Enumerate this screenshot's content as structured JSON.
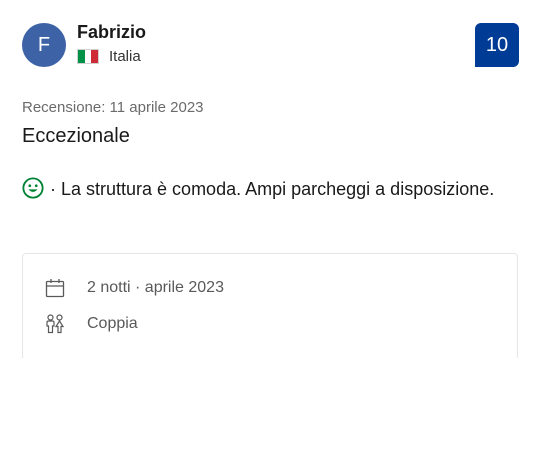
{
  "reviewer": {
    "initial": "F",
    "name": "Fabrizio",
    "country": "Italia",
    "flag_icon": "flag-italy-icon",
    "avatar_color": "#3d63a6"
  },
  "score": {
    "value": "10",
    "color": "#003b95"
  },
  "review": {
    "date": "Recensione: 11 aprile 2023",
    "title": "Eccezionale",
    "positive_icon": "smiley-icon",
    "positive_icon_color": "#008234",
    "positive_text": "· La struttura è comoda. Ampi parcheggi a disposizione."
  },
  "stay": {
    "duration": "2 notti · aprile 2023",
    "duration_icon": "calendar-icon",
    "traveler_type": "Coppia",
    "traveler_icon": "couple-icon"
  }
}
